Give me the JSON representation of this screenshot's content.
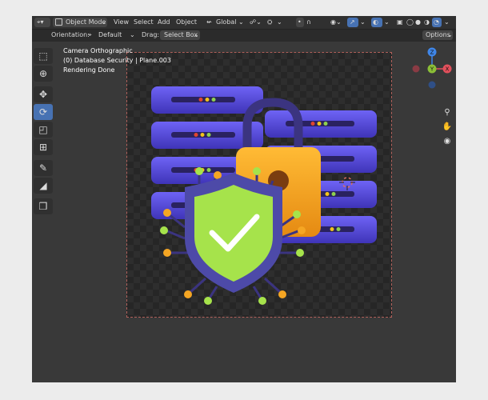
{
  "header": {
    "mode_label": "Object Mode",
    "menus": [
      "View",
      "Select",
      "Add",
      "Object"
    ],
    "transform_orientation": "Global"
  },
  "tool_settings": {
    "orientation_label": "Orientation:",
    "orientation_value": "Default",
    "drag_label": "Drag:",
    "drag_value": "Select Box",
    "options_label": "Options"
  },
  "viewport": {
    "overlay": {
      "view_name": "Camera Orthographic",
      "object_info": "(0) Database Security | Plane.003",
      "status": "Rendering Done"
    },
    "gizmo": {
      "x_color": "#e2505c",
      "y_color": "#8bbf37",
      "z_color": "#3f86e8"
    },
    "nav_icons": [
      "zoom-icon",
      "hand-pan-icon",
      "camera-icon"
    ]
  },
  "toolbar": {
    "tools": [
      "select-box-icon",
      "cursor-icon",
      "move-icon",
      "rotate-icon",
      "scale-icon",
      "transform-icon",
      "annotate-icon",
      "measure-icon",
      "add-cube-icon"
    ],
    "active_tool": "rotate-icon"
  },
  "render": {
    "subject": "database security illustration",
    "colors": {
      "server": "#5b4fe6",
      "server_dark": "#3a2fa8",
      "lock": "#f5a623",
      "shield_frame": "#4d4aa8",
      "shield_fill": "#a6e34b",
      "led_red": "#e0452f",
      "led_yellow": "#f2c31c",
      "led_green": "#8fd14f"
    }
  }
}
